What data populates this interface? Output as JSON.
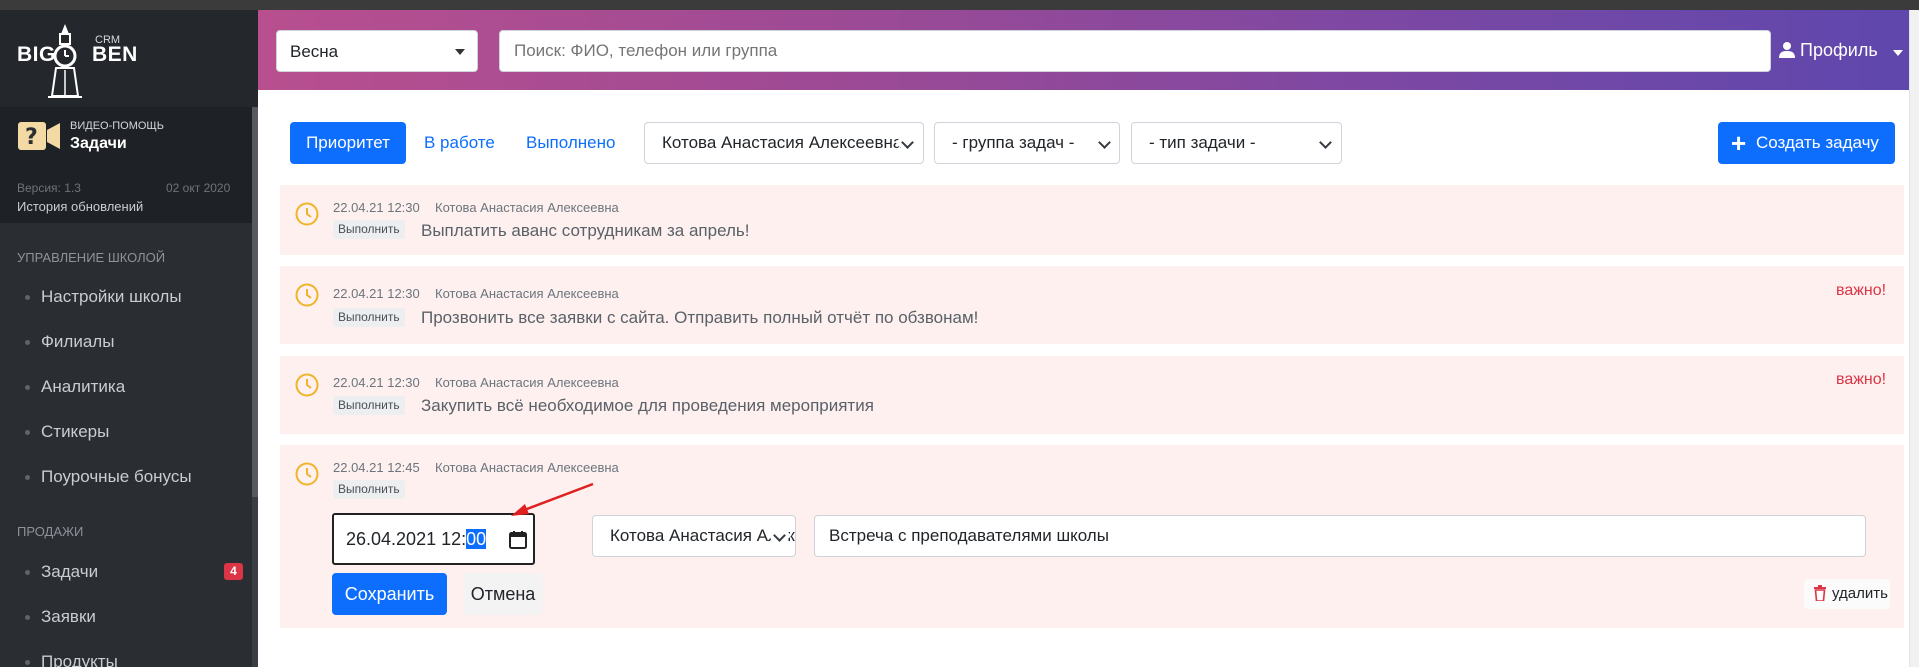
{
  "brand": {
    "left": "BIG",
    "right": "BEN",
    "suffix": "CRM"
  },
  "help": {
    "small": "ВИДЕО-ПОМОЩЬ",
    "title": "Задачи"
  },
  "version": {
    "label": "Версия: 1.3",
    "date": "02 окт 2020",
    "history": "История обновлений"
  },
  "sidebar": {
    "sections": [
      {
        "title": "УПРАВЛЕНИЕ ШКОЛОЙ",
        "items": [
          "Настройки школы",
          "Филиалы",
          "Аналитика",
          "Стикеры",
          "Поурочные бонусы"
        ]
      },
      {
        "title": "ПРОДАЖИ",
        "items": [
          "Задачи",
          "Заявки",
          "Продукты"
        ]
      }
    ],
    "badge": "4"
  },
  "header": {
    "season": "Весна",
    "search_placeholder": "Поиск: ФИО, телефон или группа",
    "profile": "Профиль"
  },
  "toolbar": {
    "priority": "Приоритет",
    "in_work": "В работе",
    "done": "Выполнено",
    "person_filter": "Котова Анастасия Алексеевна",
    "group_filter": "- группа задач -",
    "type_filter": "- тип задачи -",
    "create": "Создать задачу"
  },
  "tasks": [
    {
      "date": "22.04.21 12:30",
      "author": "Котова Анастасия Алексеевна",
      "action": "Выполнить",
      "text": "Выплатить аванс сотрудникам за апрель!",
      "important": ""
    },
    {
      "date": "22.04.21 12:30",
      "author": "Котова Анастасия Алексеевна",
      "action": "Выполнить",
      "text": "Прозвонить все заявки с сайта. Отправить полный отчёт по обзвонам!",
      "important": "важно!"
    },
    {
      "date": "22.04.21 12:30",
      "author": "Котова Анастасия Алексеевна",
      "action": "Выполнить",
      "text": "Закупить всё необходимое для проведения мероприятия",
      "important": "важно!"
    },
    {
      "date": "22.04.21 12:45",
      "author": "Котова Анастасия Алексеевна",
      "action": "Выполнить",
      "text": "",
      "important": ""
    }
  ],
  "edit": {
    "date_main": "26.04.2021 12:",
    "date_selected": "00",
    "assignee": "Котова Анастасия Алексеевна",
    "description": "Встреча с преподавателями школы",
    "save": "Сохранить",
    "cancel": "Отмена",
    "delete": "удалить"
  },
  "colors": {
    "primary": "#0d6efd",
    "danger": "#dc3545",
    "task_bg": "#fdf0ef",
    "clock": "#f0b429",
    "sidebar": "#2a2d32"
  }
}
